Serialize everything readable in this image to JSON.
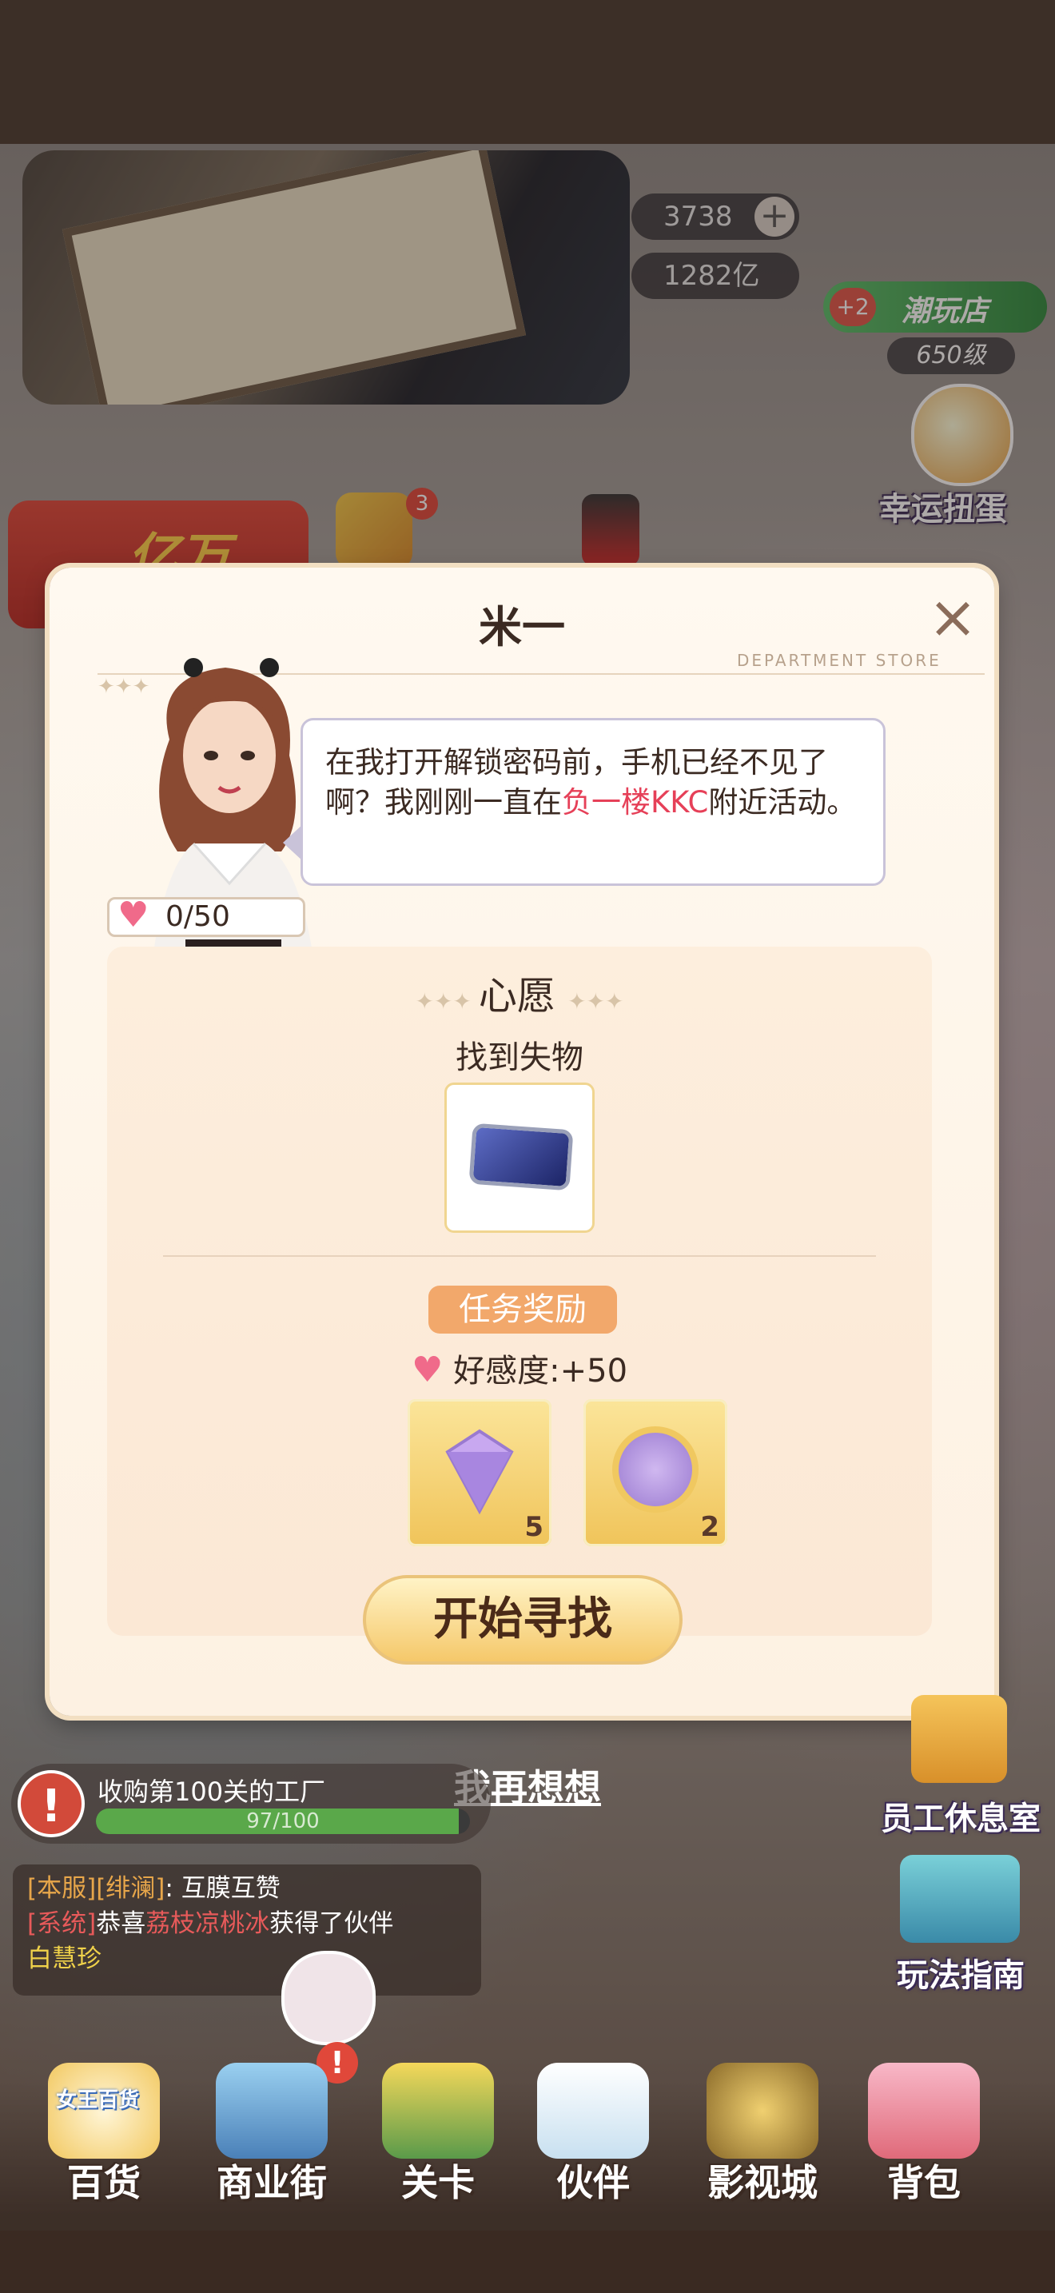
{
  "hud": {
    "diamonds": "3738",
    "coins": "1282亿",
    "shop_badge": "+2",
    "shop_name": "潮玩店",
    "shop_level": "650级",
    "tv_badge": "3",
    "promo_text": "亿万"
  },
  "side_buttons": {
    "lucky_gacha": "幸运扭蛋",
    "staff_lounge": "员工休息室",
    "guide": "玩法指南"
  },
  "modal": {
    "title": "米一",
    "tagline": "DEPARTMENT STORE",
    "dialogue_prefix": "在我打开解锁密码前，手机已经不见了啊？我刚刚一直在",
    "dialogue_highlight": "负一楼KKC",
    "dialogue_suffix": "附近活动。",
    "affection": "0/50",
    "wish_title": "心愿",
    "wish_task": "找到失物",
    "reward_tag": "任务奖励",
    "favor_label": "好感度",
    "favor_value": ":+50",
    "rewards": [
      {
        "name": "purple-diamond",
        "count": "5"
      },
      {
        "name": "sofa-coin",
        "count": "2"
      }
    ],
    "start_button": "开始寻找",
    "rethink_link": "我再想想"
  },
  "quest": {
    "text": "收购第100关的工厂",
    "progress_text": "97/100",
    "progress": 0.97
  },
  "chat": {
    "line1_server": "[本服]",
    "line1_name": "[绯澜]",
    "line1_msg": ": 互膜互赞",
    "line2_system": "[系统]",
    "line2_pre": "恭喜",
    "line2_player": "荔枝凉桃冰",
    "line2_post": "获得了伙伴",
    "line3": "白慧珍"
  },
  "nav": {
    "items": [
      {
        "label": "百货",
        "icon_text": "女王百货"
      },
      {
        "label": "商业街"
      },
      {
        "label": "关卡"
      },
      {
        "label": "伙伴"
      },
      {
        "label": "影视城"
      },
      {
        "label": "背包"
      }
    ]
  },
  "colors": {
    "highlight": "#e64058",
    "reward_tag": "#f2a86b",
    "button": "#f5c86a",
    "progress": "#5aa84a"
  }
}
